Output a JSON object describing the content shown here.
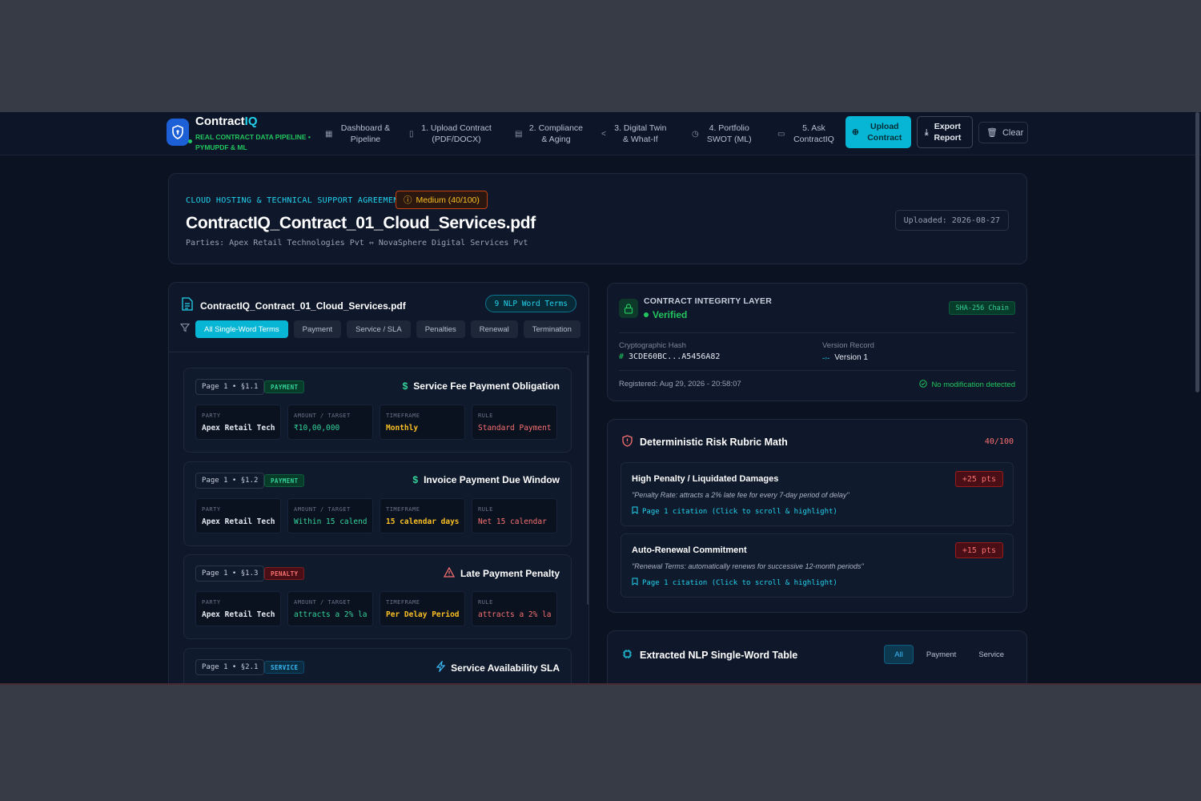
{
  "header": {
    "brand_main": "Contract",
    "brand_accent": "IQ",
    "tagline": "REAL CONTRACT DATA PIPELINE • PYMUPDF & ML",
    "nav": [
      {
        "label": "Dashboard & Pipeline",
        "icon": "grid-icon"
      },
      {
        "label": "1. Upload Contract (PDF/DOCX)",
        "icon": "file-icon"
      },
      {
        "label": "2. Compliance & Aging",
        "icon": "calendar-icon"
      },
      {
        "label": "3. Digital Twin & What-If",
        "icon": "share-icon"
      },
      {
        "label": "4. Portfolio SWOT (ML)",
        "icon": "clock-icon"
      },
      {
        "label": "5. Ask ContractIQ",
        "icon": "chat-icon"
      }
    ],
    "upload_label": "Upload Contract",
    "export_label": "Export Report",
    "clear_label": "Clear"
  },
  "summary": {
    "doc_type": "CLOUD HOSTING & TECHNICAL SUPPORT AGREEMENT",
    "risk_badge": "Medium (40/100)",
    "title": "ContractIQ_Contract_01_Cloud_Services.pdf",
    "parties": "Parties: Apex Retail Technologies Pvt ⇔ NovaSphere Digital Services Pvt",
    "uploaded": "Uploaded: 2026-08-27"
  },
  "terms_panel": {
    "title": "ContractIQ_Contract_01_Cloud_Services.pdf",
    "nlp_badge": "9 NLP Word Terms",
    "filters": [
      "All Single-Word Terms",
      "Payment",
      "Service / SLA",
      "Penalties",
      "Renewal",
      "Termination"
    ],
    "field_labels": [
      "PARTY",
      "AMOUNT / TARGET",
      "TIMEFRAME",
      "RULE"
    ],
    "clauses": [
      {
        "page": "Page 1 • §1.1",
        "tag": "PAYMENT",
        "title": "Service Fee Payment Obligation",
        "party": "Apex Retail Tech…",
        "amount": "₹10,00,000",
        "timeframe": "Monthly",
        "rule": "Standard Payment"
      },
      {
        "page": "Page 1 • §1.2",
        "tag": "PAYMENT",
        "title": "Invoice Payment Due Window",
        "party": "Apex Retail Tech…",
        "amount": "Within 15 calend…",
        "timeframe": "15 calendar days",
        "rule": "Net 15 calendar …"
      },
      {
        "page": "Page 1 • §1.3",
        "tag": "PENALTY",
        "title": "Late Payment Penalty",
        "party": "Apex Retail Tech…",
        "amount": "attracts a 2% la…",
        "timeframe": "Per Delay Period",
        "rule": "attracts a 2% la…"
      },
      {
        "page": "Page 1 • §2.1",
        "tag": "SERVICE",
        "title": "Service Availability SLA"
      }
    ]
  },
  "integrity": {
    "title": "CONTRACT INTEGRITY LAYER",
    "status": "Verified",
    "badge": "SHA-256 Chain",
    "hash_label": "Cryptographic Hash",
    "hash_value": "3CDE60BC...A5456A82",
    "version_label": "Version Record",
    "version_value": "Version 1",
    "registered": "Registered: Aug 29, 2026 - 20:58:07",
    "no_mod": "No modification detected"
  },
  "rubric": {
    "title": "Deterministic Risk Rubric Math",
    "score": "40/100",
    "items": [
      {
        "title": "High Penalty / Liquidated Damages",
        "points": "+25 pts",
        "quote": "\"Penalty Rate: attracts a 2% late fee for every 7-day period of delay\"",
        "citation": "Page 1 citation (Click to scroll & highlight)"
      },
      {
        "title": "Auto-Renewal Commitment",
        "points": "+15 pts",
        "quote": "\"Renewal Terms: automatically renews for successive 12-month periods\"",
        "citation": "Page 1 citation (Click to scroll & highlight)"
      }
    ]
  },
  "nlp_table": {
    "title": "Extracted NLP Single-Word Table",
    "tabs": [
      "All",
      "Payment",
      "Service"
    ]
  },
  "colors": {
    "background": "#0b1221",
    "card": "#0f172a",
    "accent": "#06b6d4",
    "success": "#22c55e",
    "danger": "#f87171",
    "warning": "#fbbf24"
  }
}
